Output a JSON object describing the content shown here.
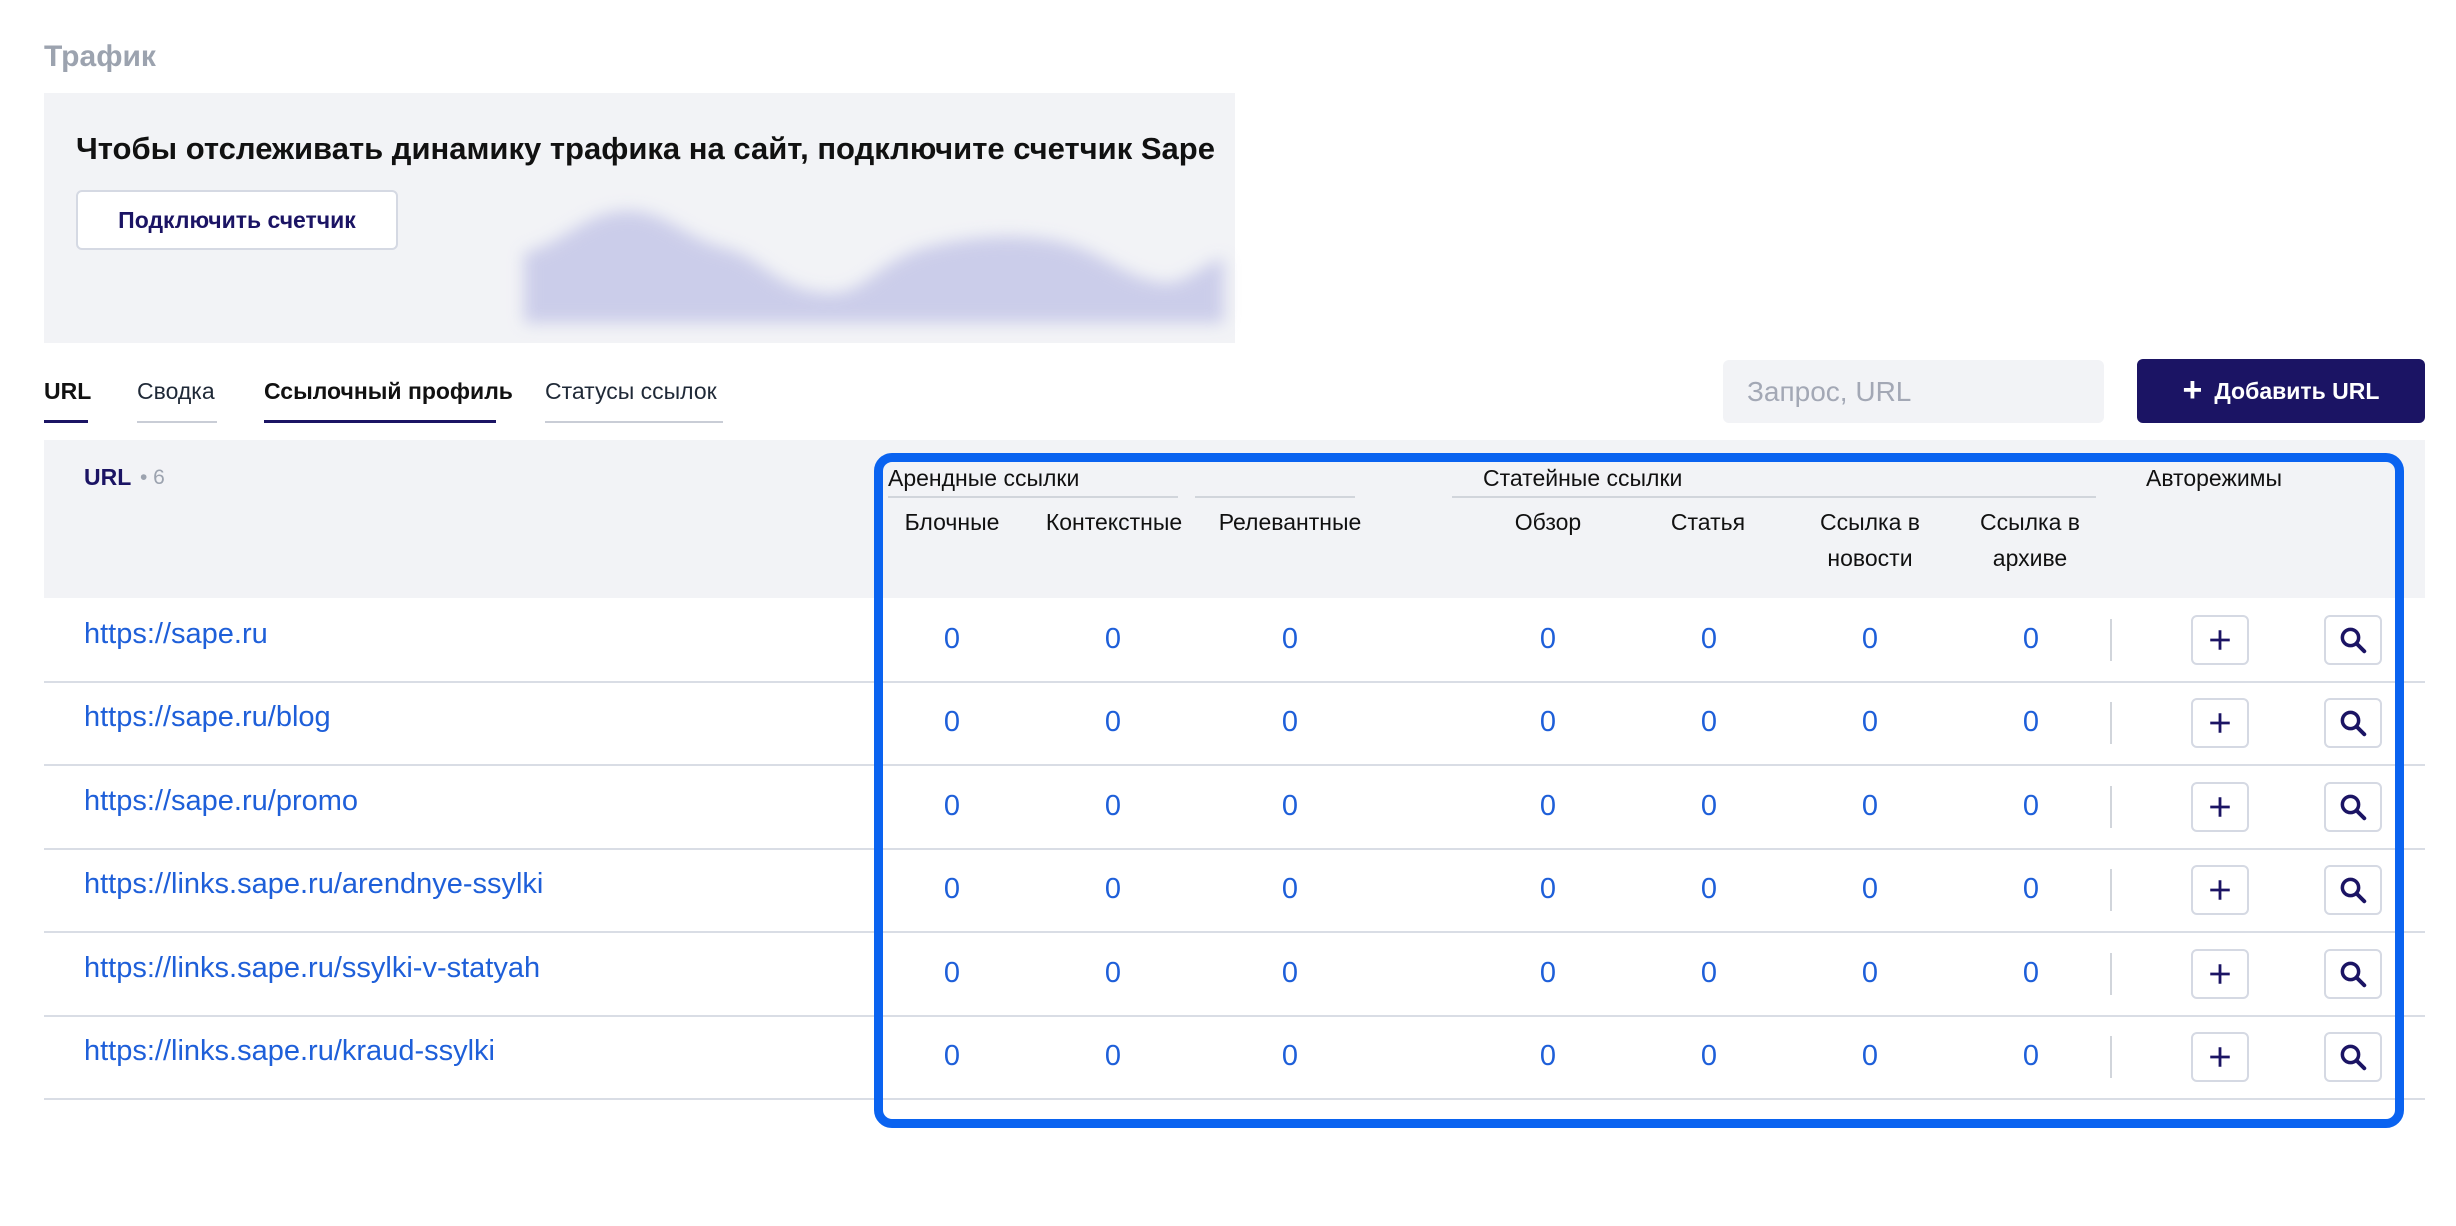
{
  "section_title": "Трафик",
  "banner": {
    "text": "Чтобы отслеживать динамику трафика на сайт, подключите счетчик Sape",
    "button": "Подключить счетчик"
  },
  "tabs": [
    {
      "label": "URL",
      "active": true
    },
    {
      "label": "Сводка",
      "active": false
    },
    {
      "label": "Ссылочный профиль",
      "active": true
    },
    {
      "label": "Статусы ссылок",
      "active": false
    }
  ],
  "search": {
    "placeholder": "Запрос, URL",
    "icon": "search-icon"
  },
  "add_button": {
    "label": "Добавить URL",
    "icon": "plus-icon"
  },
  "table": {
    "url_header": "URL",
    "url_count": "• 6",
    "groups": {
      "rent": "Арендные ссылки",
      "articles": "Статейные ссылки",
      "auto": "Авторежимы"
    },
    "columns": {
      "blocks": "Блочные",
      "contextual": "Контекстные",
      "relevant": "Релевантные",
      "review": "Обзор",
      "article": "Статья",
      "news_line1": "Ссылка в",
      "news_line2": "новости",
      "archive_line1": "Ссылка в",
      "archive_line2": "архиве"
    },
    "rows": [
      {
        "url": "https://sape.ru",
        "v": [
          "0",
          "0",
          "0",
          "0",
          "0",
          "0",
          "0"
        ]
      },
      {
        "url": "https://sape.ru/blog",
        "v": [
          "0",
          "0",
          "0",
          "0",
          "0",
          "0",
          "0"
        ]
      },
      {
        "url": "https://sape.ru/promo",
        "v": [
          "0",
          "0",
          "0",
          "0",
          "0",
          "0",
          "0"
        ]
      },
      {
        "url": "https://links.sape.ru/arendnye-ssylki",
        "v": [
          "0",
          "0",
          "0",
          "0",
          "0",
          "0",
          "0"
        ]
      },
      {
        "url": "https://links.sape.ru/ssylki-v-statyah",
        "v": [
          "0",
          "0",
          "0",
          "0",
          "0",
          "0",
          "0"
        ]
      },
      {
        "url": "https://links.sape.ru/kraud-ssylki",
        "v": [
          "0",
          "0",
          "0",
          "0",
          "0",
          "0",
          "0"
        ]
      }
    ]
  },
  "colors": {
    "brand": "#1b1464",
    "link": "#1e5fd9",
    "highlight": "#0a63f0"
  }
}
